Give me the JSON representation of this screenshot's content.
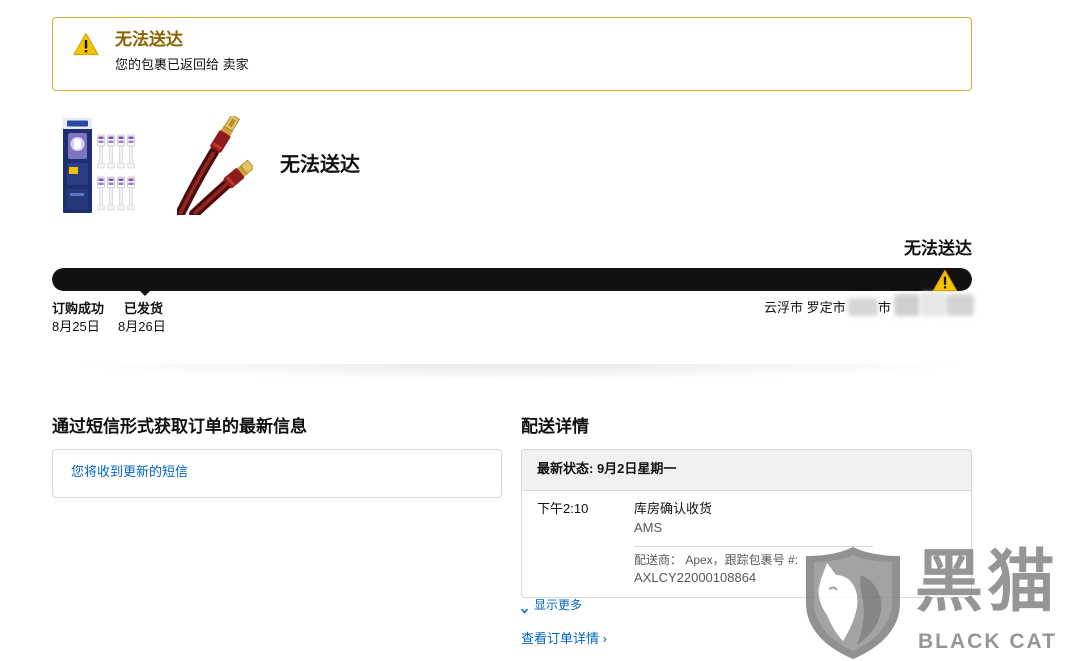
{
  "alert": {
    "icon": "warning-icon",
    "title": "无法送达",
    "message": "您的包裹已返回给 卖家"
  },
  "shipment": {
    "heading": "无法送达",
    "products": [
      {
        "icon": "toothbrush-heads-product-image"
      },
      {
        "icon": "usb-cable-product-image"
      }
    ]
  },
  "tracker": {
    "status_label": "无法送达",
    "progress": 1.0,
    "end_icon": "warning-icon",
    "milestones": [
      {
        "label": "订购成功",
        "date": "8月25日"
      },
      {
        "label": "已发货",
        "date": "8月26日"
      }
    ],
    "location": "云浮市 罗定市",
    "location_fragment": "市"
  },
  "sms": {
    "heading": "通过短信形式获取订单的最新信息",
    "link": "您将收到更新的短信"
  },
  "delivery": {
    "heading": "配送详情",
    "latest_status": "最新状态: 9月2日星期一",
    "events": [
      {
        "time": "下午2:10",
        "status": "库房确认收货",
        "location": "AMS"
      }
    ],
    "carrier_line": "配送商： Apex，跟踪包裹号 #:",
    "tracking_number": "AXLCY22000108864",
    "show_more": "显示更多",
    "view_order": "查看订单详情 ›"
  },
  "watermark": {
    "icon": "cat-shield-icon",
    "brand_cn": "黑猫",
    "brand_en": "BLACK CAT"
  },
  "colors": {
    "link": "#0066c0",
    "alert_border": "#d5ab3c",
    "alert_title": "#8a6300",
    "progress_bar": "#111111",
    "warning": "#f5c400",
    "watermark": "#7f7f7f"
  }
}
